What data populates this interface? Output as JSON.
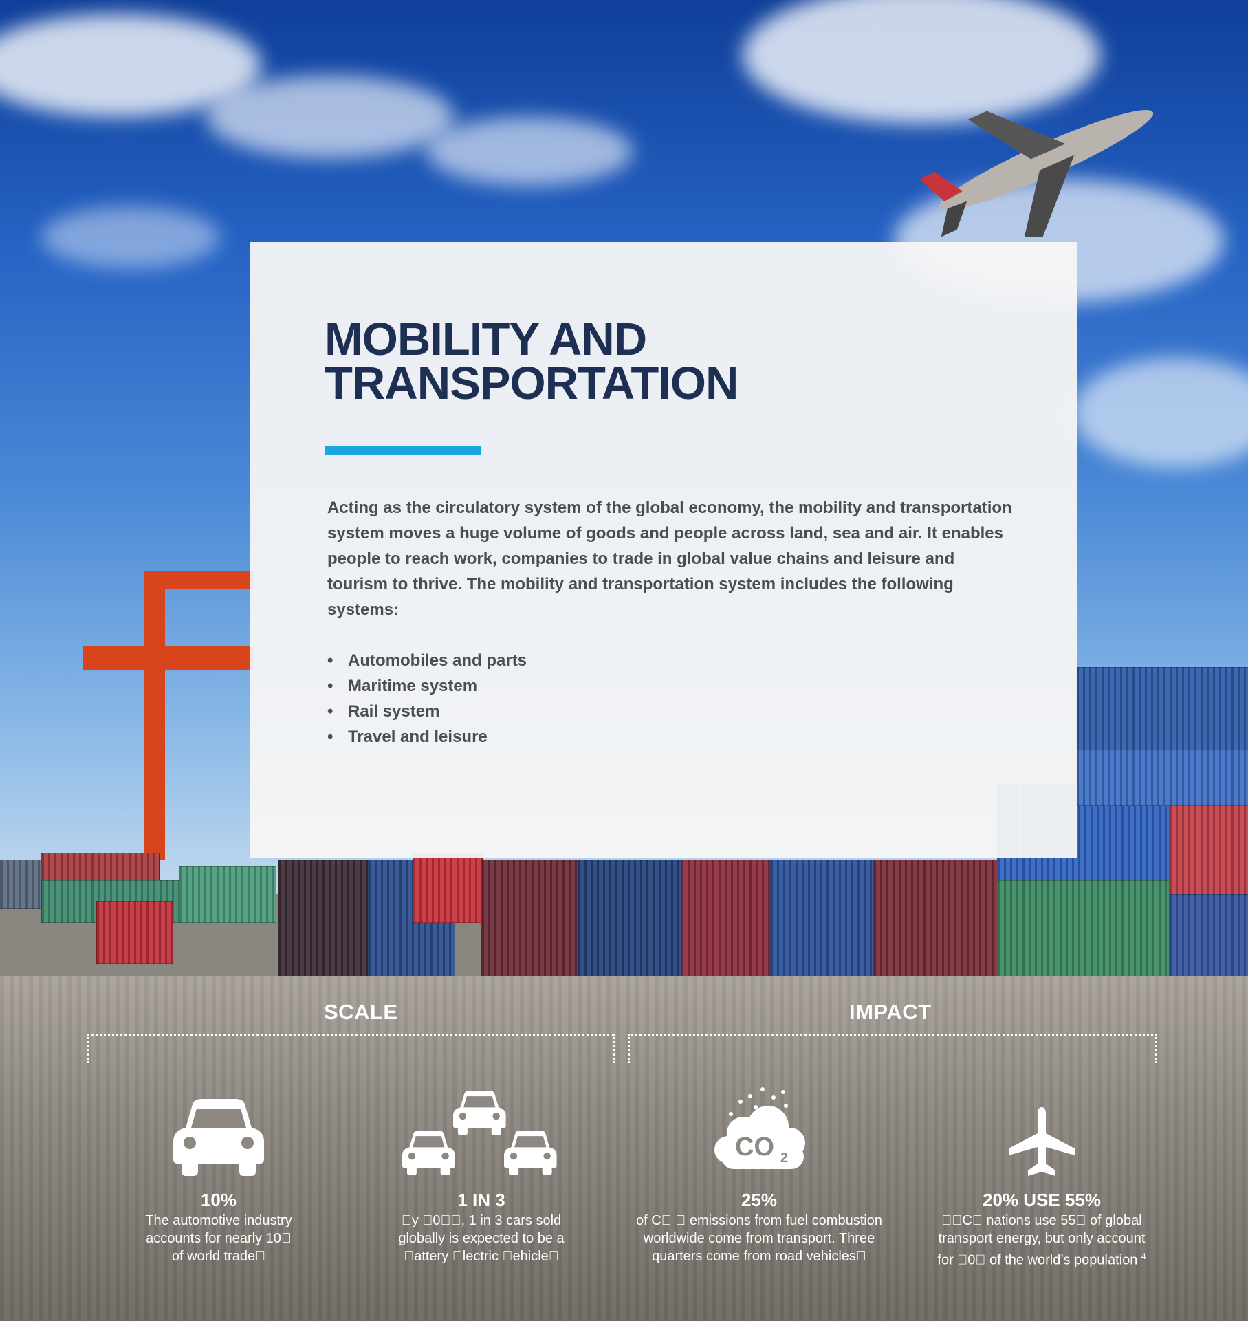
{
  "page": {
    "title_line1": "MOBILITY AND",
    "title_line2": "TRANSPORTATION",
    "intro": "Acting as the circulatory system of the global economy, the mobility and transportation system moves a huge volume of goods and people across land, sea and air. It enables people to reach work, companies to trade in global value chains and leisure and tourism to thrive. The mobility and transportation system includes the following systems:",
    "systems": [
      "Automobiles and parts",
      "Maritime system",
      "Rail system",
      "Travel and leisure"
    ]
  },
  "sections": {
    "scale": "SCALE",
    "impact": "IMPACT"
  },
  "stats": [
    {
      "icon": "car-icon",
      "value": "10%",
      "desc_lines": [
        "The automotive industry",
        "accounts for nearly 10\u0000",
        "of world trade\u0000"
      ]
    },
    {
      "icon": "three-cars-icon",
      "value": "1 IN 3",
      "desc_lines": [
        "\u0000y \u00000\u0000\u0000, 1 in 3 cars sold",
        "globally is expected to be a",
        "\u0000attery \u0000lectric \u0000ehicle\u0000"
      ]
    },
    {
      "icon": "co2-cloud-icon",
      "value": "25%",
      "desc_lines": [
        "of C\u0000 \u0000 emissions from fuel combustion",
        "worldwide come from transport. Three",
        "quarters come from road vehicles\u0000"
      ]
    },
    {
      "icon": "airplane-icon",
      "value": "20% USE 55%",
      "desc_lines": [
        "\u0000\u0000C\u0000 nations use 55\u0000 of global",
        "transport energy, but only account",
        "for \u00000\u0000 of the world’s population"
      ],
      "footnote": "4"
    }
  ],
  "colors": {
    "title": "#1d2f52",
    "accent_rule": "#19a7e0",
    "body_text": "#4a4d52",
    "stat_text": "#ffffff"
  }
}
